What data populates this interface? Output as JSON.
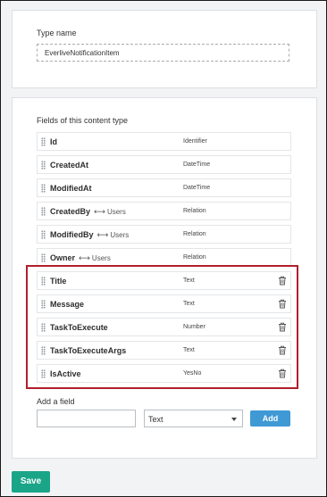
{
  "type_section": {
    "label": "Type name",
    "value": "EverliveNotificationItem"
  },
  "fields_section": {
    "label": "Fields of this content type",
    "fields": [
      {
        "name": "Id",
        "type": "Identifier",
        "deletable": false
      },
      {
        "name": "CreatedAt",
        "type": "DateTime",
        "deletable": false
      },
      {
        "name": "ModifiedAt",
        "type": "DateTime",
        "deletable": false
      },
      {
        "name": "CreatedBy",
        "relation_arrow": "⟷",
        "relation_target": "Users",
        "type": "Relation",
        "deletable": false
      },
      {
        "name": "ModifiedBy",
        "relation_arrow": "⟷",
        "relation_target": "Users",
        "type": "Relation",
        "deletable": false
      },
      {
        "name": "Owner",
        "relation_arrow": "⟷",
        "relation_target": "Users",
        "type": "Relation",
        "deletable": false
      },
      {
        "name": "Title",
        "type": "Text",
        "deletable": true
      },
      {
        "name": "Message",
        "type": "Text",
        "deletable": true
      },
      {
        "name": "TaskToExecute",
        "type": "Number",
        "deletable": true
      },
      {
        "name": "TaskToExecuteArgs",
        "type": "Text",
        "deletable": true
      },
      {
        "name": "IsActive",
        "type": "YesNo",
        "deletable": true
      }
    ]
  },
  "add_field": {
    "label": "Add a field",
    "name_value": "",
    "type_selected": "Text",
    "button_label": "Add"
  },
  "save_label": "Save",
  "colors": {
    "highlight": "#b11f2b",
    "add_button": "#3f99d4",
    "save_button": "#1aa588"
  },
  "icons": {
    "drag": "drag-handle-icon",
    "delete": "trash-icon",
    "relation": "bidirectional-arrow-icon",
    "dropdown": "caret-down-icon"
  }
}
